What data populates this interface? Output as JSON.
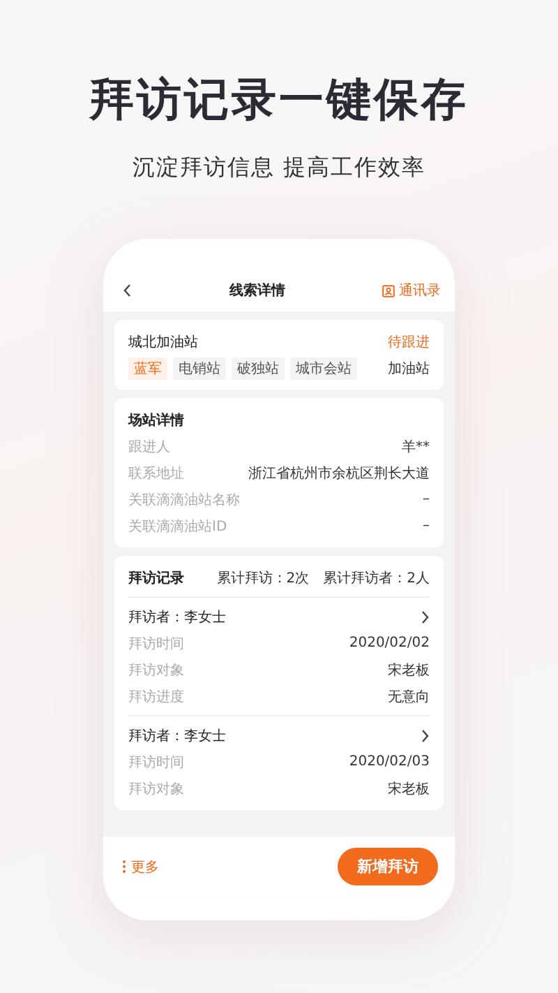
{
  "headline": "拜访记录一键保存",
  "subheadline": "沉淀拜访信息 提高工作效率",
  "nav": {
    "title": "线索详情",
    "action": "通讯录"
  },
  "station": {
    "name": "城北加油站",
    "status": "待跟进",
    "type": "加油站",
    "tags": [
      {
        "label": "蓝军",
        "color": "#f26a1b"
      },
      {
        "label": "电销站",
        "color": "#555555"
      },
      {
        "label": "破独站",
        "color": "#555555"
      },
      {
        "label": "城市会站",
        "color": "#555555"
      }
    ]
  },
  "details": {
    "title": "场站详情",
    "rows": [
      {
        "label": "跟进人",
        "value": "羊**"
      },
      {
        "label": "联系地址",
        "value": "浙江省杭州市余杭区荆长大道"
      },
      {
        "label": "关联滴滴油站名称",
        "value": "–"
      },
      {
        "label": "关联滴滴油站ID",
        "value": "–"
      }
    ]
  },
  "visits": {
    "title": "拜访记录",
    "total_visits": "累计拜访：2次",
    "total_visitors": "累计拜访者：2人",
    "records": [
      {
        "visitor": "拜访者：李女士",
        "rows": [
          {
            "label": "拜访时间",
            "value": "2020/02/02"
          },
          {
            "label": "拜访对象",
            "value": "宋老板"
          },
          {
            "label": "拜访进度",
            "value": "无意向"
          }
        ]
      },
      {
        "visitor": "拜访者：李女士",
        "rows": [
          {
            "label": "拜访时间",
            "value": "2020/02/03"
          },
          {
            "label": "拜访对象",
            "value": "宋老板"
          }
        ]
      }
    ]
  },
  "bottom_bar": {
    "more": "更多",
    "primary_button": "新增拜访"
  }
}
